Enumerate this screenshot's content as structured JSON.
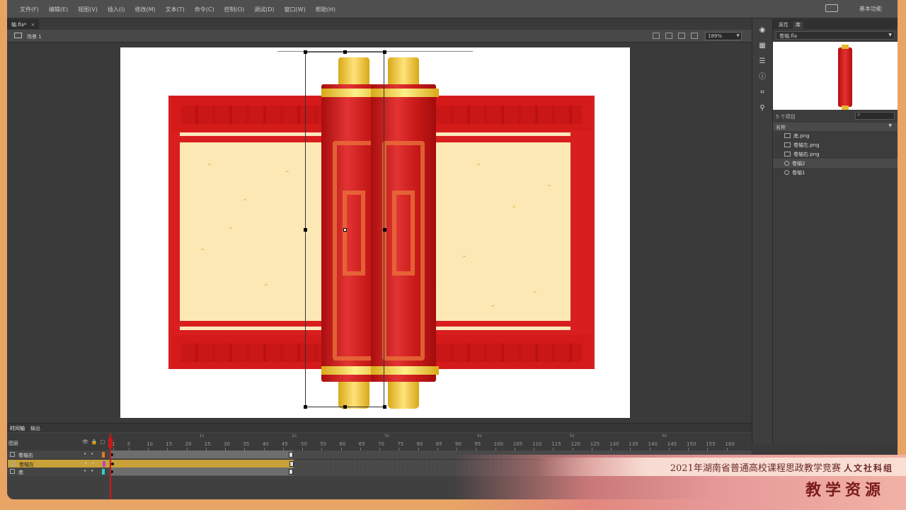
{
  "menu": [
    "文件(F)",
    "编辑(E)",
    "视图(V)",
    "插入(I)",
    "修改(M)",
    "文本(T)",
    "命令(C)",
    "控制(O)",
    "调试(D)",
    "窗口(W)",
    "帮助(H)"
  ],
  "workspace": "基本功能",
  "doc_tab": {
    "label": "轴.fla*",
    "close": "×"
  },
  "scene": "场景 1",
  "zoom": "189%",
  "library": {
    "tabs": [
      "属性",
      "库"
    ],
    "file": "卷轴.fla",
    "count": "5 个项目",
    "header": "名称",
    "items": [
      {
        "name": "底.png",
        "type": "bitmap"
      },
      {
        "name": "卷轴左.png",
        "type": "bitmap"
      },
      {
        "name": "卷轴右.png",
        "type": "bitmap"
      },
      {
        "name": "卷轴2",
        "type": "symbol"
      },
      {
        "name": "卷轴1",
        "type": "symbol"
      }
    ]
  },
  "timeline": {
    "tabs": [
      "时间轴",
      "输出"
    ],
    "header": "图层",
    "seconds": [
      "1s",
      "2s",
      "3s",
      "4s",
      "5s",
      "6s"
    ],
    "frame_numbers": [
      "1",
      "5",
      "10",
      "15",
      "20",
      "25",
      "30",
      "35",
      "40",
      "45",
      "50",
      "55",
      "60",
      "65",
      "70",
      "75",
      "80",
      "85",
      "90",
      "95",
      "100",
      "105",
      "110",
      "115",
      "120",
      "125",
      "130",
      "135",
      "140",
      "145",
      "150",
      "155",
      "160"
    ],
    "layers": [
      {
        "name": "卷轴右",
        "color": "#e07a20",
        "selected": false
      },
      {
        "name": "卷轴左",
        "color": "#c040c0",
        "selected": true
      },
      {
        "name": "底",
        "color": "#30d0d0",
        "selected": false
      }
    ]
  },
  "banner": {
    "line1": "2021年湖南省普通高校课程思政教学竞赛",
    "line1_group": "人文社科组",
    "line2": "教学资源"
  }
}
